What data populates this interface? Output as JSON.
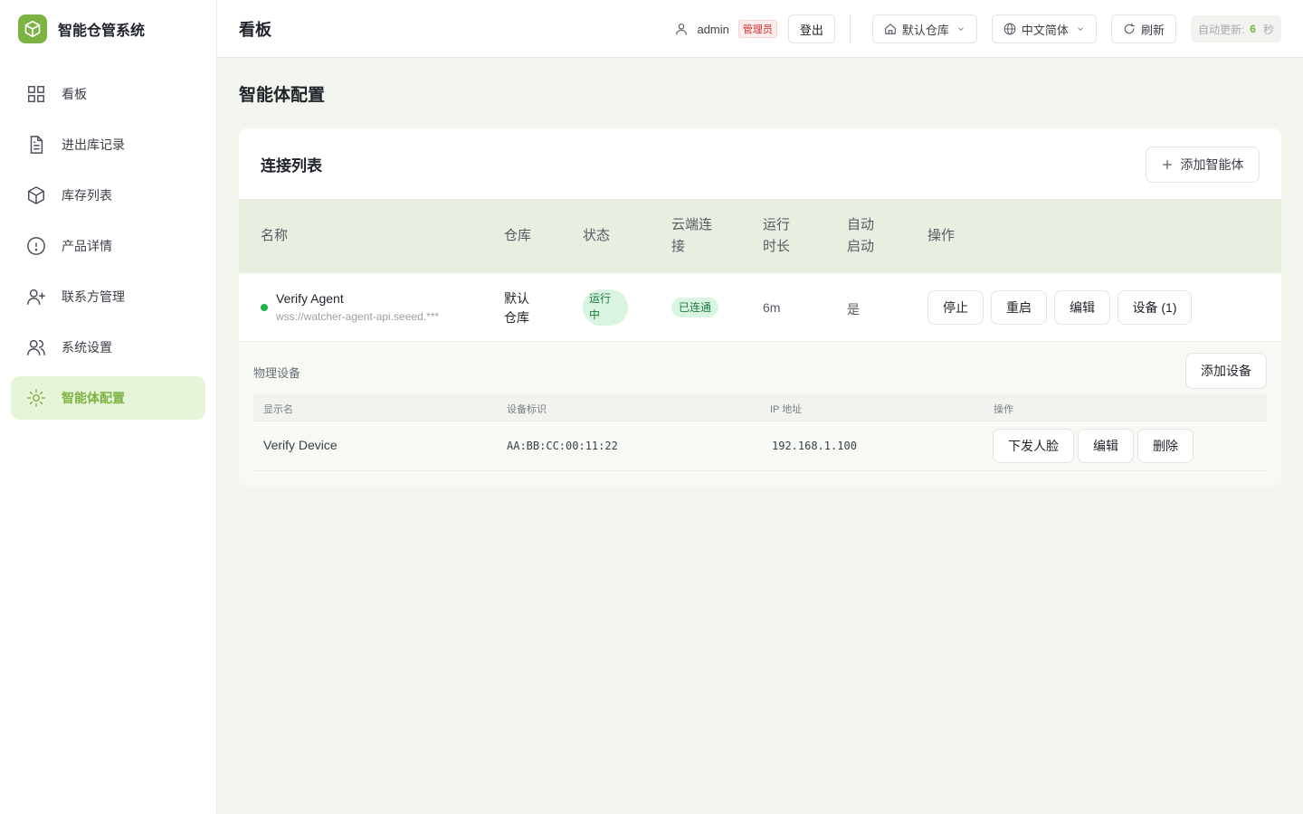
{
  "brand": {
    "name": "智能仓管系统",
    "logo_icon": "cube-icon",
    "accent": "#7cb342"
  },
  "sidebar": {
    "items": [
      {
        "label": "看板",
        "icon": "grid-icon",
        "active": false
      },
      {
        "label": "进出库记录",
        "icon": "document-icon",
        "active": false
      },
      {
        "label": "库存列表",
        "icon": "cube-icon",
        "active": false
      },
      {
        "label": "产品详情",
        "icon": "info-icon",
        "active": false
      },
      {
        "label": "联系方管理",
        "icon": "user-plus-icon",
        "active": false
      },
      {
        "label": "系统设置",
        "icon": "users-icon",
        "active": false
      },
      {
        "label": "智能体配置",
        "icon": "sun-icon",
        "active": true
      }
    ]
  },
  "header": {
    "title": "看板",
    "username": "admin",
    "role": "管理员",
    "logout_label": "登出",
    "warehouse_label": "默认仓库",
    "language_label": "中文简体",
    "refresh_label": "刷新",
    "auto_refresh_prefix": "自动更新:",
    "auto_refresh_value": "6",
    "auto_refresh_unit": "秒"
  },
  "page": {
    "title": "智能体配置"
  },
  "connections": {
    "title": "连接列表",
    "add_label": "添加智能体",
    "columns": {
      "name": "名称",
      "warehouse_1": "仓库",
      "status": "状态",
      "cloud_1": "云端连",
      "cloud_2": "接",
      "runtime_1": "运行",
      "runtime_2": "时长",
      "autostart_1": "自动",
      "autostart_2": "启动",
      "actions": "操作"
    },
    "row": {
      "name": "Verify Agent",
      "url": "wss://watcher-agent-api.seeed.***",
      "warehouse_1": "默认",
      "warehouse_2": "仓库",
      "status_1": "运行",
      "status_2": "中",
      "cloud": "已连通",
      "runtime": "6m",
      "autostart": "是",
      "stop_label": "停止",
      "restart_label": "重启",
      "edit_label": "编辑",
      "devices_label": "设备 (1)"
    }
  },
  "devices": {
    "title": "物理设备",
    "add_label": "添加设备",
    "columns": {
      "display_name": "显示名",
      "device_id": "设备标识",
      "ip": "IP 地址",
      "actions": "操作"
    },
    "rows": [
      {
        "display_name": "Verify Device",
        "device_id": "AA:BB:CC:00:11:22",
        "ip": "192.168.1.100",
        "push_face_label": "下发人脸",
        "edit_label": "编辑",
        "delete_label": "删除"
      }
    ]
  }
}
